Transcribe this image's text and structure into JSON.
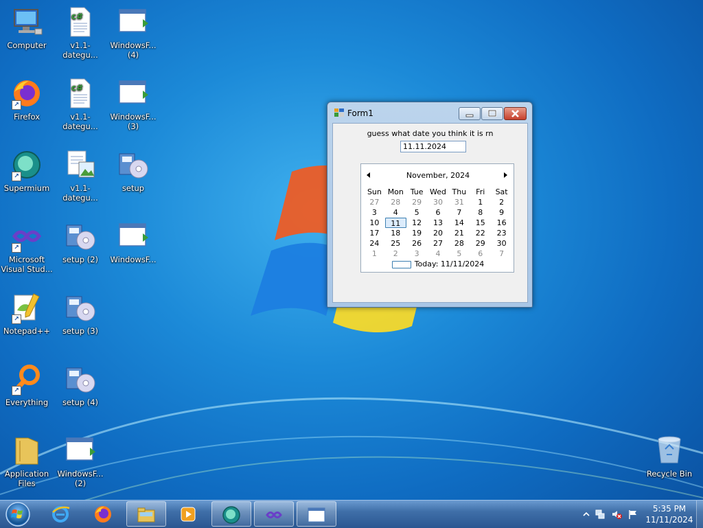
{
  "desktop": {
    "icons": [
      {
        "label": "Computer",
        "icon": "computer-icon"
      },
      {
        "label": "v1.1-dategu...",
        "icon": "csharp-file-icon"
      },
      {
        "label": "WindowsF... (4)",
        "icon": "window-app-icon"
      },
      {
        "label": "Firefox",
        "icon": "firefox-icon"
      },
      {
        "label": "v1.1-dategu...",
        "icon": "csharp-file-icon"
      },
      {
        "label": "WindowsF... (3)",
        "icon": "window-app-icon"
      },
      {
        "label": "Supermium",
        "icon": "supermium-icon"
      },
      {
        "label": "v1.1-dategu...",
        "icon": "document-image-icon"
      },
      {
        "label": "setup",
        "icon": "setup-icon"
      },
      {
        "label": "Microsoft Visual Stud...",
        "icon": "visual-studio-icon"
      },
      {
        "label": "setup (2)",
        "icon": "setup-icon"
      },
      {
        "label": "WindowsF...",
        "icon": "window-app-icon"
      },
      {
        "label": "Notepad++",
        "icon": "notepad-plus-icon"
      },
      {
        "label": "setup (3)",
        "icon": "setup-icon"
      },
      {
        "label": "Everything",
        "icon": "everything-search-icon"
      },
      {
        "label": "setup (4)",
        "icon": "setup-icon"
      },
      {
        "label": "Application Files",
        "icon": "folder-icon"
      },
      {
        "label": "WindowsF... (2)",
        "icon": "window-app-icon"
      },
      {
        "label": "Recycle Bin",
        "icon": "recycle-bin-icon"
      }
    ]
  },
  "window": {
    "title": "Form1",
    "prompt": "guess what date you think it is rn",
    "date_value": "11.11.2024",
    "calendar": {
      "month_label": "November, 2024",
      "weekdays": [
        "Sun",
        "Mon",
        "Tue",
        "Wed",
        "Thu",
        "Fri",
        "Sat"
      ],
      "weeks": [
        [
          "27",
          "28",
          "29",
          "30",
          "31",
          "1",
          "2"
        ],
        [
          "3",
          "4",
          "5",
          "6",
          "7",
          "8",
          "9"
        ],
        [
          "10",
          "11",
          "12",
          "13",
          "14",
          "15",
          "16"
        ],
        [
          "17",
          "18",
          "19",
          "20",
          "21",
          "22",
          "23"
        ],
        [
          "24",
          "25",
          "26",
          "27",
          "28",
          "29",
          "30"
        ],
        [
          "1",
          "2",
          "3",
          "4",
          "5",
          "6",
          "7"
        ]
      ],
      "today_label": "Today: 11/11/2024"
    }
  },
  "taskbar": {
    "items": [
      "start-orb",
      "internet-explorer-icon",
      "firefox-icon",
      "file-explorer-icon",
      "media-player-icon",
      "supermium-icon",
      "visual-studio-icon",
      "form-window-icon"
    ],
    "clock_time": "5:35 PM",
    "clock_date": "11/11/2024"
  }
}
